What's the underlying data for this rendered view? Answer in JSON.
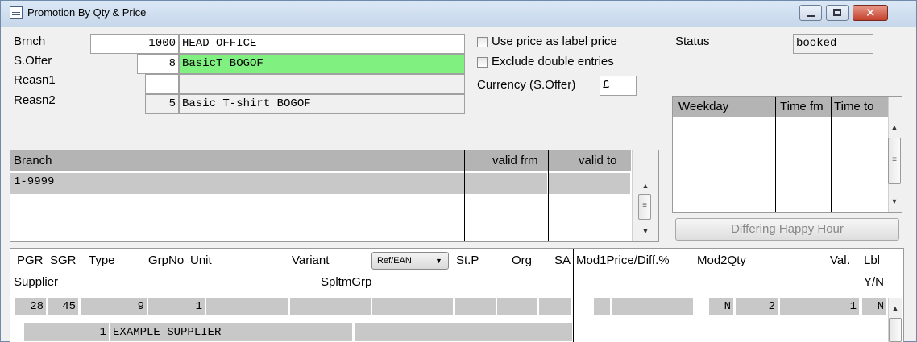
{
  "window": {
    "title": "Promotion By Qty & Price"
  },
  "form": {
    "brnch_label": "Brnch",
    "brnch_code": "1000",
    "brnch_name": "HEAD OFFICE",
    "soffer_label": "S.Offer",
    "soffer_code": "8",
    "soffer_name": "BasicT BOGOF",
    "reasn1_label": "Reasn1",
    "reasn1_code": "",
    "reasn1_name": "",
    "reasn2_label": "Reasn2",
    "reasn2_code": "5",
    "reasn2_name": "Basic T-shirt BOGOF",
    "use_price_label": "Use price as label price",
    "exclude_double_label": "Exclude double entries",
    "currency_label": "Currency (S.Offer)",
    "currency_value": "£",
    "status_label": "Status",
    "status_value": "booked"
  },
  "branch_grid": {
    "headers": {
      "branch": "Branch",
      "valid_frm": "valid frm",
      "valid_to": "valid to"
    },
    "rows": [
      {
        "branch": "1-9999",
        "valid_frm": "",
        "valid_to": ""
      }
    ]
  },
  "weekday_grid": {
    "headers": {
      "weekday": "Weekday",
      "time_fm": "Time fm",
      "time_to": "Time to"
    },
    "button": "Differing Happy Hour"
  },
  "item_grid": {
    "headers": {
      "pgr": "PGR",
      "sgr": "SGR",
      "type": "Type",
      "grpno": "GrpNo",
      "unit": "Unit",
      "variant": "Variant",
      "ref_ean": "Ref/EAN",
      "stp": "St.P",
      "org": "Org",
      "sa": "SA",
      "mod1": "Mod1Price/Diff.%",
      "mod2": "Mod2Qty",
      "val": "Val.",
      "lbl": "Lbl",
      "supplier": "Supplier",
      "spltmgrp": "SpltmGrp",
      "yn": "Y/N"
    },
    "row": {
      "pgr": "28",
      "sgr": "45",
      "type": "9",
      "grpno": "1",
      "mod2": "N",
      "mod2qty": "2",
      "val": "1",
      "lbl": "N",
      "supplier_no": "1",
      "supplier_name": "EXAMPLE SUPPLIER"
    }
  },
  "colors": {
    "highlight": "#80f080",
    "header_gray": "#b4b4b4"
  }
}
